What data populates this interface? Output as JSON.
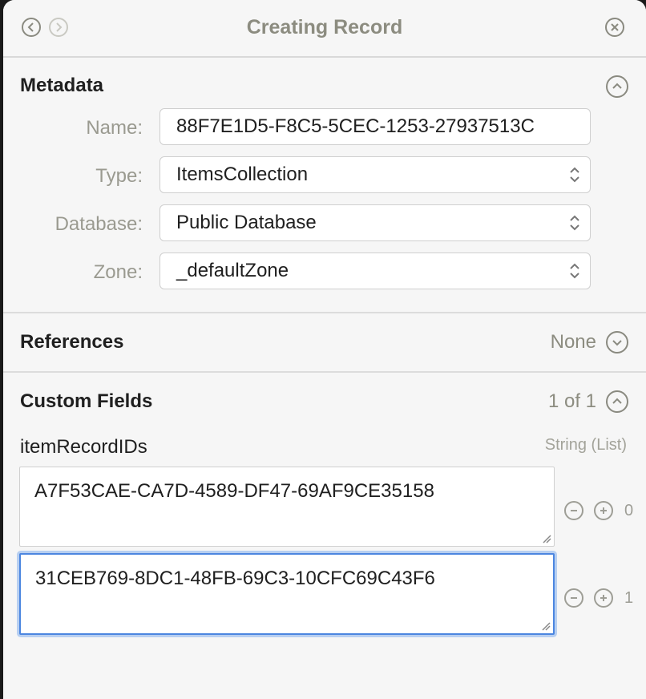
{
  "window": {
    "title": "Creating Record",
    "back_icon": "chevron-left-icon",
    "forward_icon": "chevron-right-icon",
    "close_icon": "close-icon"
  },
  "metadata": {
    "title": "Metadata",
    "collapse_icon": "chevron-up-icon",
    "fields": {
      "name": {
        "label": "Name:",
        "value": "88F7E1D5-F8C5-5CEC-1253-27937513C"
      },
      "type": {
        "label": "Type:",
        "value": "ItemsCollection"
      },
      "database": {
        "label": "Database:",
        "value": "Public Database"
      },
      "zone": {
        "label": "Zone:",
        "value": "_defaultZone"
      }
    }
  },
  "references": {
    "title": "References",
    "status": "None",
    "expand_icon": "chevron-down-icon"
  },
  "custom_fields": {
    "title": "Custom Fields",
    "count": "1 of 1",
    "collapse_icon": "chevron-up-icon",
    "field_name": "itemRecordIDs",
    "field_type": "String (List)",
    "items": [
      {
        "value": "A7F53CAE-CA7D-4589-DF47-69AF9CE35158",
        "index": "0"
      },
      {
        "value": "31CEB769-8DC1-48FB-69C3-10CFC69C43F6",
        "index": "1"
      }
    ]
  },
  "colors": {
    "accent_focus": "#4c86e0",
    "panel_bg": "#f6f6f6",
    "muted_text": "#8c8c80"
  }
}
